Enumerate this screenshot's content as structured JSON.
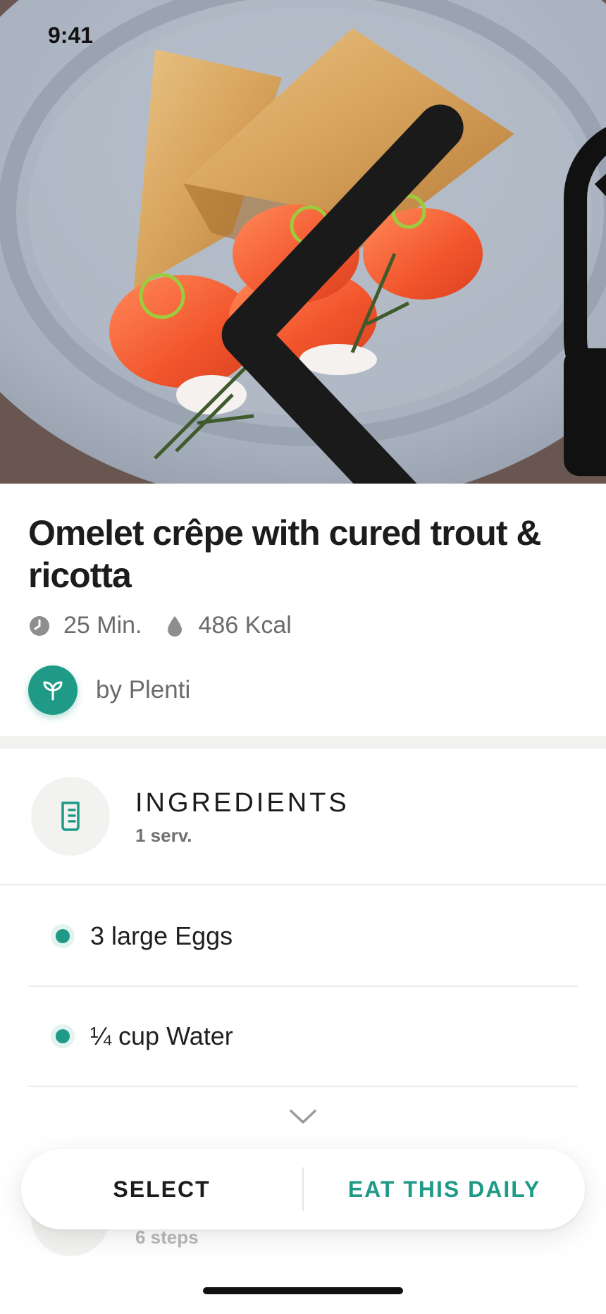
{
  "status_bar": {
    "time": "9:41"
  },
  "recipe": {
    "title": "Omelet crêpe with cured trout & ricotta",
    "time": "25 Min.",
    "calories": "486 Kcal",
    "author": "by Plenti"
  },
  "ingredients": {
    "title": "INGREDIENTS",
    "servings": "1 serv.",
    "items": [
      {
        "text": "3 large Eggs"
      },
      {
        "text": "¼ cup Water"
      }
    ]
  },
  "next_section": {
    "subtitle": "6 steps"
  },
  "actions": {
    "select_label": "SELECT",
    "daily_label": "EAT THIS DAILY"
  },
  "colors": {
    "accent": "#1f9a86",
    "text": "#1c1c1c",
    "muted": "#6b6b6b"
  },
  "icons": {
    "back": "chevron-left-icon",
    "time": "clock-icon",
    "calories": "drop-icon",
    "author": "sprout-icon",
    "ingredients": "measuring-cup-icon",
    "expand": "chevron-down-icon"
  }
}
